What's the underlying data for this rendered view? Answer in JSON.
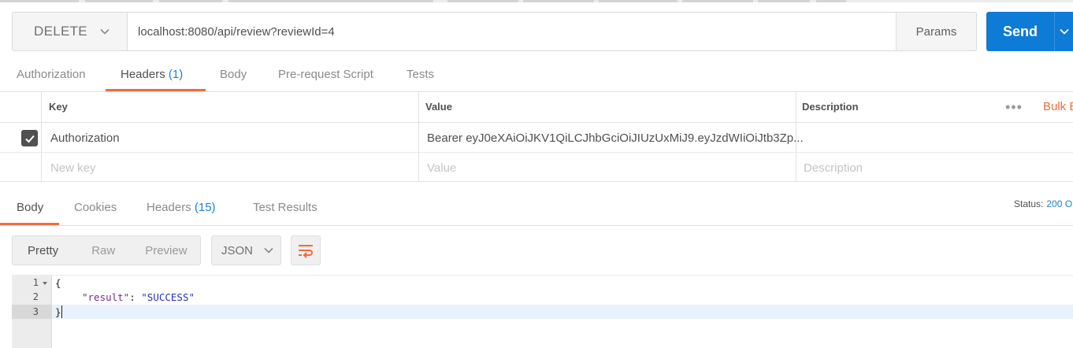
{
  "request": {
    "method": "DELETE",
    "url": "localhost:8080/api/review?reviewId=4",
    "params_label": "Params",
    "send_label": "Send"
  },
  "request_tabs": [
    {
      "label": "Authorization",
      "count": ""
    },
    {
      "label": "Headers",
      "count": "(1)"
    },
    {
      "label": "Body",
      "count": ""
    },
    {
      "label": "Pre-request Script",
      "count": ""
    },
    {
      "label": "Tests",
      "count": ""
    }
  ],
  "headers_table": {
    "columns": {
      "key": "Key",
      "value": "Value",
      "description": "Description"
    },
    "bulk_edit_label": "Bulk E",
    "more_label": "•••",
    "rows": [
      {
        "checked": true,
        "key": "Authorization",
        "value": "Bearer eyJ0eXAiOiJKV1QiLCJhbGciOiJIUzUxMiJ9.eyJzdWIiOiJtb3Zp...",
        "description": ""
      }
    ],
    "new_row": {
      "key_placeholder": "New key",
      "value_placeholder": "Value",
      "description_placeholder": "Description"
    }
  },
  "response_tabs": [
    {
      "label": "Body",
      "count": ""
    },
    {
      "label": "Cookies",
      "count": ""
    },
    {
      "label": "Headers",
      "count": "(15)"
    },
    {
      "label": "Test Results",
      "count": ""
    }
  ],
  "status": {
    "label": "Status:",
    "value": "200 O"
  },
  "view_modes": [
    "Pretty",
    "Raw",
    "Preview"
  ],
  "format": "JSON",
  "code": {
    "line_numbers": [
      "1",
      "2",
      "3"
    ],
    "line1": "{",
    "line2_key": "\"result\"",
    "line2_sep": ": ",
    "line2_value": "\"SUCCESS\"",
    "line3": "}"
  }
}
